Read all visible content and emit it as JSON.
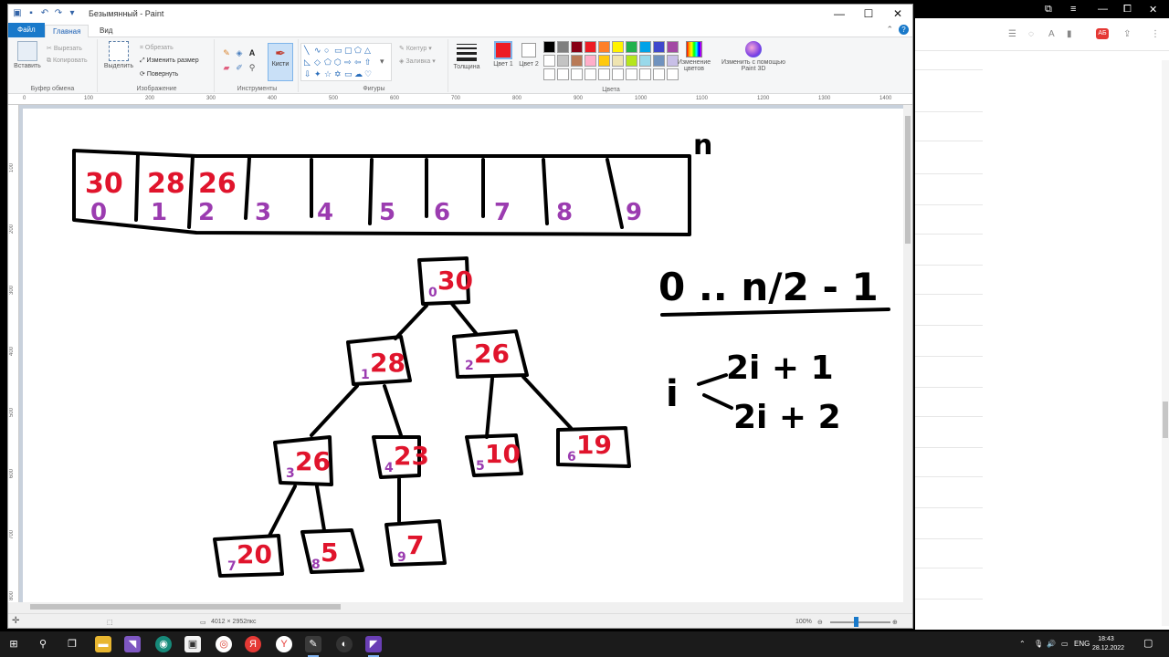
{
  "window": {
    "title": "Безымянный - Paint",
    "controls": {
      "minimize": "—",
      "maximize": "☐",
      "close": "✕"
    }
  },
  "tabs": {
    "file": "Файл",
    "home": "Главная",
    "view": "Вид"
  },
  "ribbon": {
    "clipboard": {
      "label": "Буфер обмена",
      "paste": "Вставить",
      "cut": "Вырезать",
      "copy": "Копировать"
    },
    "image": {
      "label": "Изображение",
      "select": "Выделить",
      "crop": "Обрезать",
      "resize": "Изменить размер",
      "rotate": "Повернуть"
    },
    "tools": {
      "label": "Инструменты"
    },
    "brushes": "Кисти",
    "shapes": {
      "label": "Фигуры",
      "outline": "Контур",
      "fill": "Заливка"
    },
    "thickness": "Толщина",
    "color1": "Цвет 1",
    "color2": "Цвет 2",
    "colors_label": "Цвета",
    "edit_colors": "Изменение цветов",
    "paint3d": "Изменить с помощью Paint 3D",
    "color1_value": "#ed1c24",
    "palette": [
      "#000000",
      "#7f7f7f",
      "#880015",
      "#ed1c24",
      "#ff7f27",
      "#fff200",
      "#22b14c",
      "#00a2e8",
      "#3f48cc",
      "#a349a4",
      "#ffffff",
      "#c3c3c3",
      "#b97a57",
      "#ffaec9",
      "#ffc90e",
      "#efe4b0",
      "#b5e61d",
      "#99d9ea",
      "#7092be",
      "#c8bfe7",
      "#ffffff",
      "#ffffff",
      "#ffffff",
      "#ffffff",
      "#ffffff",
      "#ffffff",
      "#ffffff",
      "#ffffff",
      "#ffffff",
      "#ffffff"
    ]
  },
  "ruler": {
    "h": [
      "0",
      "100",
      "200",
      "300",
      "400",
      "500",
      "600",
      "700",
      "800",
      "900",
      "1000",
      "1100",
      "1200",
      "1300",
      "1400"
    ],
    "v": [
      "100",
      "200",
      "300",
      "400",
      "500",
      "600",
      "700",
      "800"
    ]
  },
  "status": {
    "size": "4012 × 2952пкс",
    "zoom": "100%"
  },
  "drawing": {
    "n_label": "n",
    "array_values": [
      "30",
      "28",
      "26"
    ],
    "array_indices": [
      "0",
      "1",
      "2",
      "3",
      "4",
      "5",
      "6",
      "7",
      "8",
      "9"
    ],
    "range_text": "0 .. n/2 - 1",
    "formula_i": "i",
    "formula_left": "2i + 1",
    "formula_right": "2i + 2",
    "tree": {
      "root": {
        "value": "30",
        "index": "0"
      },
      "level1": [
        {
          "value": "28",
          "index": "1"
        },
        {
          "value": "26",
          "index": "2"
        }
      ],
      "level2": [
        {
          "value": "26",
          "index": "3"
        },
        {
          "value": "23",
          "index": "4"
        },
        {
          "value": "10",
          "index": "5"
        },
        {
          "value": "19",
          "index": "6"
        }
      ],
      "level3": [
        {
          "value": "20",
          "index": "7"
        },
        {
          "value": "5",
          "index": "8"
        },
        {
          "value": "7",
          "index": "9"
        }
      ]
    }
  },
  "taskbar": {
    "time": "18:43",
    "date": "28.12.2022",
    "lang": "ENG"
  }
}
